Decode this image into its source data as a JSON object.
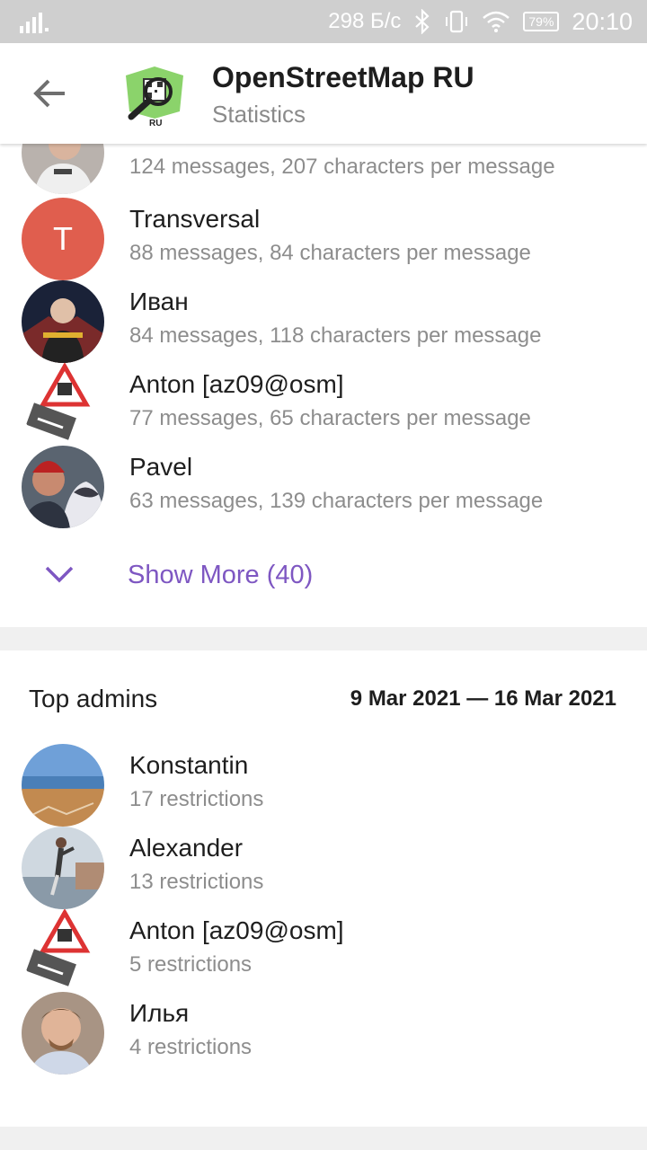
{
  "status_bar": {
    "speed": "298 Б/с",
    "battery": "79%",
    "time": "20:10"
  },
  "header": {
    "title": "OpenStreetMap RU",
    "subtitle": "Statistics"
  },
  "top_members": {
    "partial_row_meta": "124 messages, 207 characters per message",
    "items": [
      {
        "name": "Transversal",
        "meta": "88 messages, 84 characters per message",
        "initial": "T"
      },
      {
        "name": "Иван",
        "meta": "84 messages, 118 characters per message"
      },
      {
        "name": "Anton [az09@osm]",
        "meta": "77 messages, 65 characters per message"
      },
      {
        "name": "Pavel",
        "meta": "63 messages, 139 characters per message"
      }
    ],
    "show_more_label": "Show More (40)"
  },
  "top_admins": {
    "title": "Top admins",
    "range": "9 Mar 2021 — 16 Mar 2021",
    "items": [
      {
        "name": "Konstantin",
        "meta": "17 restrictions"
      },
      {
        "name": "Alexander",
        "meta": "13 restrictions"
      },
      {
        "name": "Anton [az09@osm]",
        "meta": "5 restrictions"
      },
      {
        "name": "Илья",
        "meta": "4 restrictions"
      }
    ]
  },
  "colors": {
    "accent": "#7e57c2",
    "avatar_letter_bg": "#e05e4e"
  }
}
